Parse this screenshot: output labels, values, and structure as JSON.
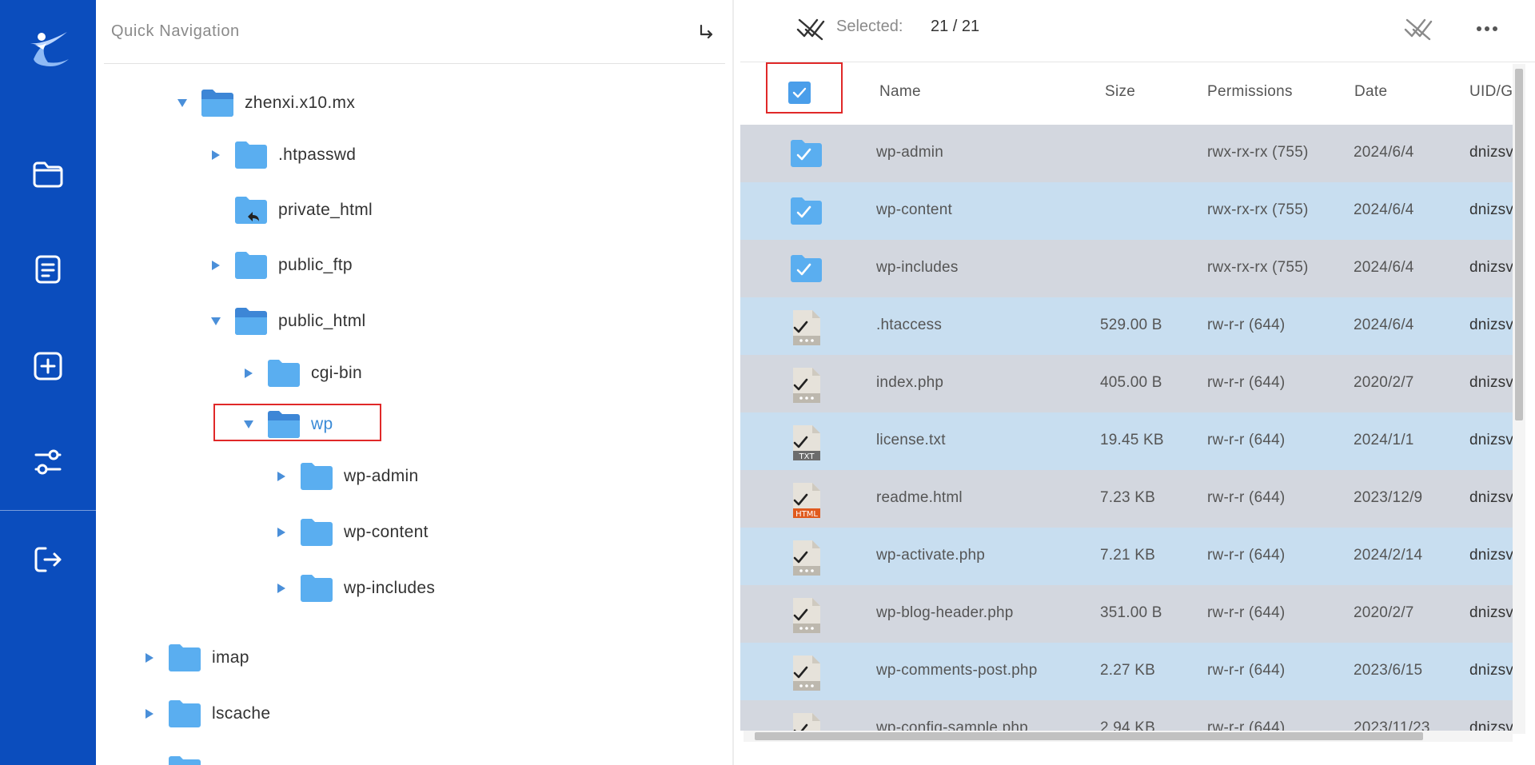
{
  "sidebar": {
    "logo": "swift-logo",
    "items": [
      {
        "name": "folder-icon"
      },
      {
        "name": "document-icon"
      },
      {
        "name": "add-icon"
      },
      {
        "name": "settings-sliders-icon"
      },
      {
        "name": "logout-icon"
      }
    ],
    "colors": {
      "background": "#0b4dbd",
      "icon": "#ffffff"
    }
  },
  "quick_nav": {
    "title": "Quick Navigation",
    "collapse_icon": "arrow-down-right-icon",
    "tree": [
      {
        "label": "zhenxi.x10.mx",
        "state": "expanded"
      },
      {
        "label": ".htpasswd",
        "state": "collapsed"
      },
      {
        "label": "private_html",
        "state": "link"
      },
      {
        "label": "public_ftp",
        "state": "collapsed"
      },
      {
        "label": "public_html",
        "state": "expanded"
      },
      {
        "label": "cgi-bin",
        "state": "collapsed"
      },
      {
        "label": "wp",
        "state": "expanded",
        "active": true
      },
      {
        "label": "wp-admin",
        "state": "collapsed"
      },
      {
        "label": "wp-content",
        "state": "collapsed"
      },
      {
        "label": "wp-includes",
        "state": "collapsed"
      },
      {
        "label": "imap",
        "state": "collapsed"
      },
      {
        "label": "lscache",
        "state": "collapsed"
      }
    ]
  },
  "toolbar": {
    "selected_label": "Selected:",
    "selected_count": "21 / 21"
  },
  "table": {
    "headers": {
      "name": "Name",
      "size": "Size",
      "permissions": "Permissions",
      "date": "Date",
      "uid": "UID/G"
    },
    "select_all_checked": true,
    "rows": [
      {
        "type": "folder",
        "name": "wp-admin",
        "size": "",
        "perm": "rwx-rx-rx (755)",
        "date": "2024/6/4",
        "uid": "dnizsv"
      },
      {
        "type": "folder",
        "name": "wp-content",
        "size": "",
        "perm": "rwx-rx-rx (755)",
        "date": "2024/6/4",
        "uid": "dnizsv"
      },
      {
        "type": "folder",
        "name": "wp-includes",
        "size": "",
        "perm": "rwx-rx-rx (755)",
        "date": "2024/6/4",
        "uid": "dnizsv"
      },
      {
        "type": "file",
        "name": ".htaccess",
        "size": "529.00 B",
        "perm": "rw-r-r (644)",
        "date": "2024/6/4",
        "uid": "dnizsv"
      },
      {
        "type": "file",
        "name": "index.php",
        "size": "405.00 B",
        "perm": "rw-r-r (644)",
        "date": "2020/2/7",
        "uid": "dnizsv"
      },
      {
        "type": "txt",
        "name": "license.txt",
        "size": "19.45 KB",
        "perm": "rw-r-r (644)",
        "date": "2024/1/1",
        "uid": "dnizsv"
      },
      {
        "type": "html",
        "name": "readme.html",
        "size": "7.23 KB",
        "perm": "rw-r-r (644)",
        "date": "2023/12/9",
        "uid": "dnizsv"
      },
      {
        "type": "file",
        "name": "wp-activate.php",
        "size": "7.21 KB",
        "perm": "rw-r-r (644)",
        "date": "2024/2/14",
        "uid": "dnizsv"
      },
      {
        "type": "file",
        "name": "wp-blog-header.php",
        "size": "351.00 B",
        "perm": "rw-r-r (644)",
        "date": "2020/2/7",
        "uid": "dnizsv"
      },
      {
        "type": "file",
        "name": "wp-comments-post.php",
        "size": "2.27 KB",
        "perm": "rw-r-r (644)",
        "date": "2023/6/15",
        "uid": "dnizsv"
      },
      {
        "type": "file",
        "name": "wp-config-sample.php",
        "size": "2.94 KB",
        "perm": "rw-r-r (644)",
        "date": "2023/11/23",
        "uid": "dnizsv"
      }
    ],
    "file_badges": {
      "txt": "TXT",
      "html": "HTML"
    }
  }
}
